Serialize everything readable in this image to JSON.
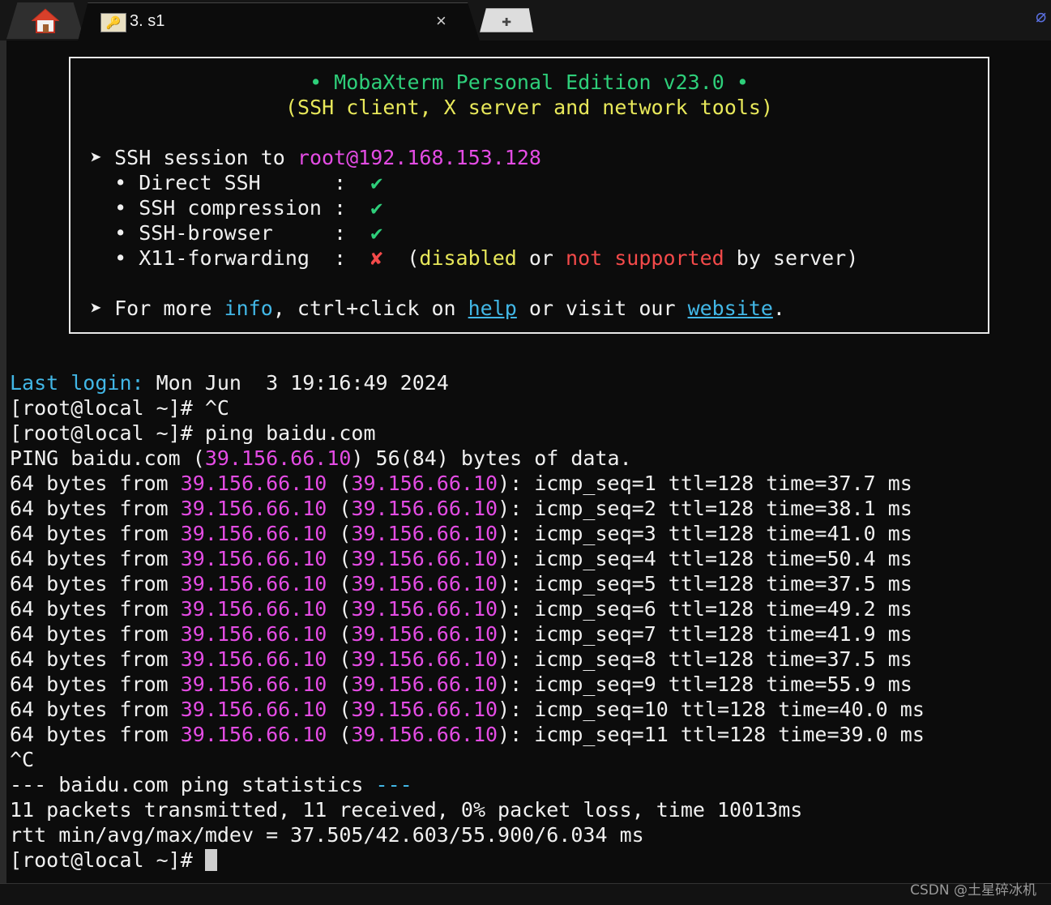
{
  "tabs": {
    "home_icon": "house-icon",
    "session_icon": "key-icon",
    "session_title": "3. s1",
    "close_glyph": "×",
    "new_tab_glyph": "✚",
    "attach_icon": "paperclip-icon"
  },
  "banner": {
    "title_line1": "• MobaXterm Personal Edition v23.0 •",
    "title_line2": "(SSH client, X server and network tools)",
    "arrow": "➤",
    "ssh_session_prefix": " SSH session to ",
    "ssh_host": "root@192.168.153.128",
    "features": [
      {
        "label": "  • Direct SSH      :  ",
        "mark": "✔"
      },
      {
        "label": "  • SSH compression :  ",
        "mark": "✔"
      },
      {
        "label": "  • SSH-browser     :  ",
        "mark": "✔"
      },
      {
        "label": "  • X11-forwarding  :  ",
        "mark": "✘"
      }
    ],
    "x11_open": "  (",
    "x11_disabled": "disabled",
    "x11_or": " or ",
    "x11_not_supported": "not supported",
    "x11_close": " by server)",
    "more_prefix": " For more ",
    "more_info": "info",
    "more_mid1": ", ctrl+click on ",
    "more_help": "help",
    "more_mid2": " or visit our ",
    "more_website": "website",
    "more_end": "."
  },
  "terminal": {
    "last_login_label": "Last login:",
    "last_login_value": " Mon Jun  3 19:16:49 2024",
    "prompt1": "[root@local ~]# ^C",
    "prompt2": "[root@local ~]# ping baidu.com",
    "ping_prefix": "PING baidu.com (",
    "ping_ip": "39.156.66.10",
    "ping_suffix": ") 56(84) bytes of data.",
    "reply_prefix": "64 bytes from ",
    "reply_ip": "39.156.66.10",
    "replies": [
      {
        "tail": "): icmp_seq=1 ttl=128 time=37.7 ms"
      },
      {
        "tail": "): icmp_seq=2 ttl=128 time=38.1 ms"
      },
      {
        "tail": "): icmp_seq=3 ttl=128 time=41.0 ms"
      },
      {
        "tail": "): icmp_seq=4 ttl=128 time=50.4 ms"
      },
      {
        "tail": "): icmp_seq=5 ttl=128 time=37.5 ms"
      },
      {
        "tail": "): icmp_seq=6 ttl=128 time=49.2 ms"
      },
      {
        "tail": "): icmp_seq=7 ttl=128 time=41.9 ms"
      },
      {
        "tail": "): icmp_seq=8 ttl=128 time=37.5 ms"
      },
      {
        "tail": "): icmp_seq=9 ttl=128 time=55.9 ms"
      },
      {
        "tail": "): icmp_seq=10 ttl=128 time=40.0 ms"
      },
      {
        "tail": "): icmp_seq=11 ttl=128 time=39.0 ms"
      }
    ],
    "interrupt": "^C",
    "stats_header_prefix": "--- baidu.com ping statistics ",
    "stats_header_suffix": "---",
    "stats_line1": "11 packets transmitted, 11 received, 0% packet loss, time 10013ms",
    "stats_line2": "rtt min/avg/max/mdev = 37.505/42.603/55.900/6.034 ms",
    "final_prompt": "[root@local ~]# "
  },
  "watermark": "CSDN @土星碎冰机",
  "colors": {
    "background": "#0c0c0c",
    "green": "#2ecf7a",
    "yellow": "#e8e85a",
    "magenta": "#e44ce4",
    "cyan": "#42b7e6",
    "red": "#f44a4a"
  }
}
